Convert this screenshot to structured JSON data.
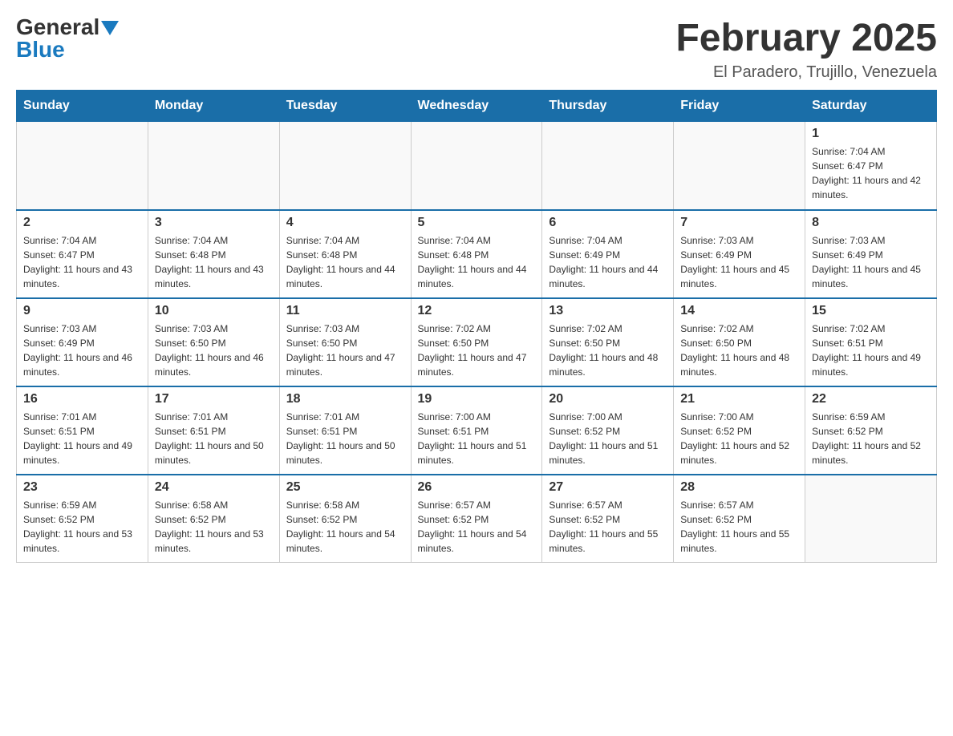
{
  "logo": {
    "general": "General",
    "blue": "Blue"
  },
  "title": {
    "month_year": "February 2025",
    "location": "El Paradero, Trujillo, Venezuela"
  },
  "days_of_week": [
    "Sunday",
    "Monday",
    "Tuesday",
    "Wednesday",
    "Thursday",
    "Friday",
    "Saturday"
  ],
  "weeks": [
    [
      {
        "day": "",
        "info": ""
      },
      {
        "day": "",
        "info": ""
      },
      {
        "day": "",
        "info": ""
      },
      {
        "day": "",
        "info": ""
      },
      {
        "day": "",
        "info": ""
      },
      {
        "day": "",
        "info": ""
      },
      {
        "day": "1",
        "info": "Sunrise: 7:04 AM\nSunset: 6:47 PM\nDaylight: 11 hours and 42 minutes."
      }
    ],
    [
      {
        "day": "2",
        "info": "Sunrise: 7:04 AM\nSunset: 6:47 PM\nDaylight: 11 hours and 43 minutes."
      },
      {
        "day": "3",
        "info": "Sunrise: 7:04 AM\nSunset: 6:48 PM\nDaylight: 11 hours and 43 minutes."
      },
      {
        "day": "4",
        "info": "Sunrise: 7:04 AM\nSunset: 6:48 PM\nDaylight: 11 hours and 44 minutes."
      },
      {
        "day": "5",
        "info": "Sunrise: 7:04 AM\nSunset: 6:48 PM\nDaylight: 11 hours and 44 minutes."
      },
      {
        "day": "6",
        "info": "Sunrise: 7:04 AM\nSunset: 6:49 PM\nDaylight: 11 hours and 44 minutes."
      },
      {
        "day": "7",
        "info": "Sunrise: 7:03 AM\nSunset: 6:49 PM\nDaylight: 11 hours and 45 minutes."
      },
      {
        "day": "8",
        "info": "Sunrise: 7:03 AM\nSunset: 6:49 PM\nDaylight: 11 hours and 45 minutes."
      }
    ],
    [
      {
        "day": "9",
        "info": "Sunrise: 7:03 AM\nSunset: 6:49 PM\nDaylight: 11 hours and 46 minutes."
      },
      {
        "day": "10",
        "info": "Sunrise: 7:03 AM\nSunset: 6:50 PM\nDaylight: 11 hours and 46 minutes."
      },
      {
        "day": "11",
        "info": "Sunrise: 7:03 AM\nSunset: 6:50 PM\nDaylight: 11 hours and 47 minutes."
      },
      {
        "day": "12",
        "info": "Sunrise: 7:02 AM\nSunset: 6:50 PM\nDaylight: 11 hours and 47 minutes."
      },
      {
        "day": "13",
        "info": "Sunrise: 7:02 AM\nSunset: 6:50 PM\nDaylight: 11 hours and 48 minutes."
      },
      {
        "day": "14",
        "info": "Sunrise: 7:02 AM\nSunset: 6:50 PM\nDaylight: 11 hours and 48 minutes."
      },
      {
        "day": "15",
        "info": "Sunrise: 7:02 AM\nSunset: 6:51 PM\nDaylight: 11 hours and 49 minutes."
      }
    ],
    [
      {
        "day": "16",
        "info": "Sunrise: 7:01 AM\nSunset: 6:51 PM\nDaylight: 11 hours and 49 minutes."
      },
      {
        "day": "17",
        "info": "Sunrise: 7:01 AM\nSunset: 6:51 PM\nDaylight: 11 hours and 50 minutes."
      },
      {
        "day": "18",
        "info": "Sunrise: 7:01 AM\nSunset: 6:51 PM\nDaylight: 11 hours and 50 minutes."
      },
      {
        "day": "19",
        "info": "Sunrise: 7:00 AM\nSunset: 6:51 PM\nDaylight: 11 hours and 51 minutes."
      },
      {
        "day": "20",
        "info": "Sunrise: 7:00 AM\nSunset: 6:52 PM\nDaylight: 11 hours and 51 minutes."
      },
      {
        "day": "21",
        "info": "Sunrise: 7:00 AM\nSunset: 6:52 PM\nDaylight: 11 hours and 52 minutes."
      },
      {
        "day": "22",
        "info": "Sunrise: 6:59 AM\nSunset: 6:52 PM\nDaylight: 11 hours and 52 minutes."
      }
    ],
    [
      {
        "day": "23",
        "info": "Sunrise: 6:59 AM\nSunset: 6:52 PM\nDaylight: 11 hours and 53 minutes."
      },
      {
        "day": "24",
        "info": "Sunrise: 6:58 AM\nSunset: 6:52 PM\nDaylight: 11 hours and 53 minutes."
      },
      {
        "day": "25",
        "info": "Sunrise: 6:58 AM\nSunset: 6:52 PM\nDaylight: 11 hours and 54 minutes."
      },
      {
        "day": "26",
        "info": "Sunrise: 6:57 AM\nSunset: 6:52 PM\nDaylight: 11 hours and 54 minutes."
      },
      {
        "day": "27",
        "info": "Sunrise: 6:57 AM\nSunset: 6:52 PM\nDaylight: 11 hours and 55 minutes."
      },
      {
        "day": "28",
        "info": "Sunrise: 6:57 AM\nSunset: 6:52 PM\nDaylight: 11 hours and 55 minutes."
      },
      {
        "day": "",
        "info": ""
      }
    ]
  ]
}
